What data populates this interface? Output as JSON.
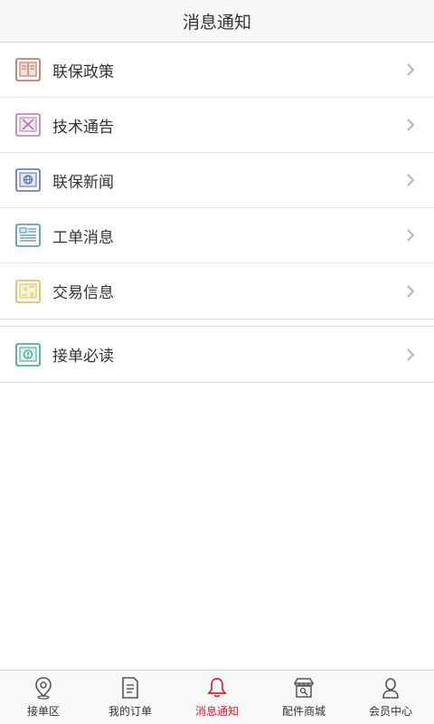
{
  "header": {
    "title": "消息通知"
  },
  "groups": [
    {
      "items": [
        {
          "label": "联保政策",
          "icon": "book-icon",
          "color": "#b8695a"
        },
        {
          "label": "技术通告",
          "icon": "tools-icon",
          "color": "#b07ab0"
        },
        {
          "label": "联保新闻",
          "icon": "globe-icon",
          "color": "#5a6aa6"
        },
        {
          "label": "工单消息",
          "icon": "form-icon",
          "color": "#4a8fb0"
        },
        {
          "label": "交易信息",
          "icon": "yen-icon",
          "color": "#d9b84a"
        }
      ]
    },
    {
      "items": [
        {
          "label": "接单必读",
          "icon": "info-icon",
          "color": "#3aa08a"
        }
      ]
    }
  ],
  "tabbar": {
    "tabs": [
      {
        "label": "接单区",
        "icon": "location-pin-icon"
      },
      {
        "label": "我的订单",
        "icon": "document-icon"
      },
      {
        "label": "消息通知",
        "icon": "bell-icon",
        "active": true
      },
      {
        "label": "配件商城",
        "icon": "store-icon"
      },
      {
        "label": "会员中心",
        "icon": "user-icon"
      }
    ],
    "active_color": "#c8282e"
  }
}
